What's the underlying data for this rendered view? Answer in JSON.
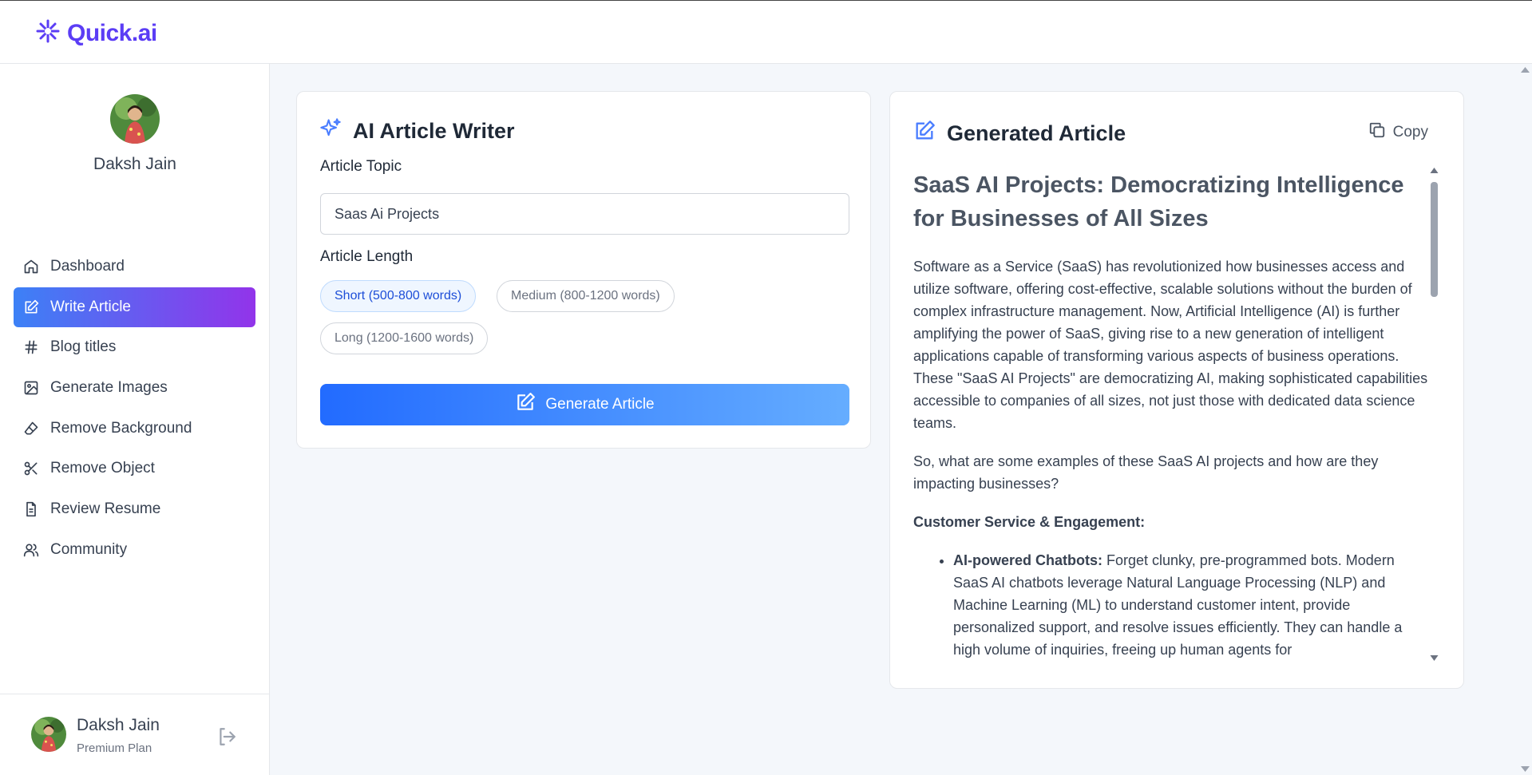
{
  "app": {
    "name": "Quick.ai",
    "brand_color": "#5b3df5"
  },
  "user": {
    "name": "Daksh Jain",
    "plan": "Premium Plan"
  },
  "sidebar": {
    "items": [
      {
        "label": "Dashboard",
        "icon": "home-icon",
        "active": false
      },
      {
        "label": "Write Article",
        "icon": "edit-icon",
        "active": true
      },
      {
        "label": "Blog titles",
        "icon": "hash-icon",
        "active": false
      },
      {
        "label": "Generate Images",
        "icon": "image-icon",
        "active": false
      },
      {
        "label": "Remove Background",
        "icon": "eraser-icon",
        "active": false
      },
      {
        "label": "Remove Object",
        "icon": "scissors-icon",
        "active": false
      },
      {
        "label": "Review Resume",
        "icon": "file-icon",
        "active": false
      },
      {
        "label": "Community",
        "icon": "users-icon",
        "active": false
      }
    ]
  },
  "writer": {
    "title": "AI Article Writer",
    "topic_label": "Article Topic",
    "topic_value": "Saas Ai Projects",
    "length_label": "Article Length",
    "lengths": [
      {
        "label": "Short (500-800 words)",
        "selected": true
      },
      {
        "label": "Medium (800-1200 words)",
        "selected": false
      },
      {
        "label": "Long (1200-1600 words)",
        "selected": false
      }
    ],
    "generate_label": "Generate Article"
  },
  "output": {
    "title": "Generated Article",
    "copy_label": "Copy",
    "heading": "SaaS AI Projects: Democratizing Intelligence for Businesses of All Sizes",
    "para1": "Software as a Service (SaaS) has revolutionized how businesses access and utilize software, offering cost-effective, scalable solutions without the burden of complex infrastructure management. Now, Artificial Intelligence (AI) is further amplifying the power of SaaS, giving rise to a new generation of intelligent applications capable of transforming various aspects of business operations. These \"SaaS AI Projects\" are democratizing AI, making sophisticated capabilities accessible to companies of all sizes, not just those with dedicated data science teams.",
    "para2": "So, what are some examples of these SaaS AI projects and how are they impacting businesses?",
    "section1": "Customer Service & Engagement:",
    "bullet1_bold": "AI-powered Chatbots:",
    "bullet1_text": " Forget clunky, pre-programmed bots. Modern SaaS AI chatbots leverage Natural Language Processing (NLP) and Machine Learning (ML) to understand customer intent, provide personalized support, and resolve issues efficiently. They can handle a high volume of inquiries, freeing up human agents for"
  }
}
